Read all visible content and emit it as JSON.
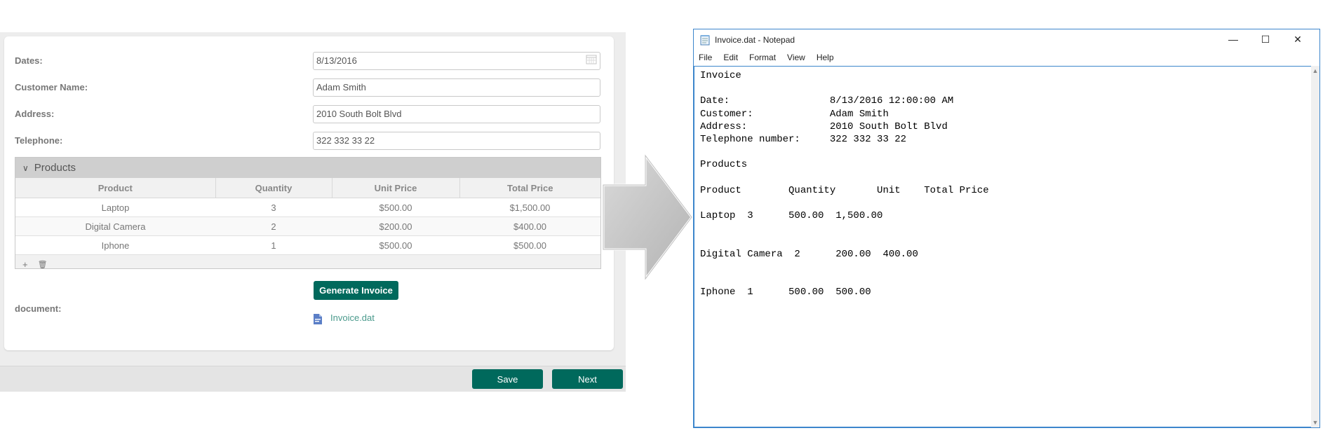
{
  "form": {
    "fields": [
      {
        "label": "Dates:",
        "value": "8/13/2016"
      },
      {
        "label": "Customer Name:",
        "value": "Adam Smith"
      },
      {
        "label": "Address:",
        "value": "2010 South Bolt Blvd"
      },
      {
        "label": "Telephone:",
        "value": "322 332 33 22"
      }
    ],
    "products": {
      "title": "Products",
      "columns": [
        "Product",
        "Quantity",
        "Unit Price",
        "Total Price"
      ],
      "rows": [
        [
          "Laptop",
          "3",
          "$500.00",
          "$1,500.00"
        ],
        [
          "Digital Camera",
          "2",
          "$200.00",
          "$400.00"
        ],
        [
          "Iphone",
          "1",
          "$500.00",
          "$500.00"
        ]
      ],
      "add_symbol": "+",
      "delete_symbol": "🗑"
    },
    "generate_label": "Generate Invoice",
    "document_label": "document:",
    "document_file": "Invoice.dat",
    "save_label": "Save",
    "next_label": "Next",
    "accent": "#00695c"
  },
  "notepad": {
    "title": "Invoice.dat - Notepad",
    "menu": [
      "File",
      "Edit",
      "Format",
      "View",
      "Help"
    ],
    "minimize": "—",
    "maximize": "☐",
    "close": "✕",
    "content": "Invoice\n\nDate:                 8/13/2016 12:00:00 AM\nCustomer:             Adam Smith\nAddress:              2010 South Bolt Blvd\nTelephone number:     322 332 33 22\n\nProducts\n\nProduct        Quantity       Unit    Total Price\n\nLaptop  3      500.00  1,500.00\n\n\nDigital Camera  2      200.00  400.00\n\n\nIphone  1      500.00  500.00"
  }
}
